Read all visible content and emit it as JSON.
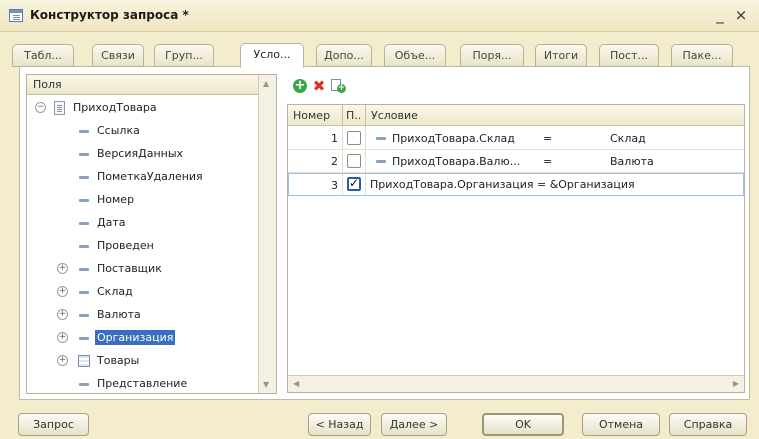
{
  "window": {
    "title": "Конструктор запроса *",
    "minimize": "_",
    "close": "×"
  },
  "tabs": [
    {
      "label": "Табл..."
    },
    {
      "label": "Связи"
    },
    {
      "label": "Груп..."
    },
    {
      "label": "Усло..."
    },
    {
      "label": "Допо..."
    },
    {
      "label": "Объе..."
    },
    {
      "label": "Поря..."
    },
    {
      "label": "Итоги"
    },
    {
      "label": "Пост..."
    },
    {
      "label": "Паке..."
    }
  ],
  "tree": {
    "header": "Поля",
    "items": [
      {
        "label": "ПриходТовара"
      },
      {
        "label": "Ссылка"
      },
      {
        "label": "ВерсияДанных"
      },
      {
        "label": "ПометкаУдаления"
      },
      {
        "label": "Номер"
      },
      {
        "label": "Дата"
      },
      {
        "label": "Проведен"
      },
      {
        "label": "Поставщик"
      },
      {
        "label": "Склад"
      },
      {
        "label": "Валюта"
      },
      {
        "label": "Организация"
      },
      {
        "label": "Товары"
      },
      {
        "label": "Представление"
      }
    ]
  },
  "conditions": {
    "columns": {
      "number": "Номер",
      "flag": "П..",
      "condition": "Условие"
    },
    "rows": [
      {
        "number": "1",
        "field": "ПриходТовара.Склад",
        "op": "=",
        "param": "Склад"
      },
      {
        "number": "2",
        "field": "ПриходТовара.Валю...",
        "op": "=",
        "param": "Валюта"
      },
      {
        "number": "3",
        "text": "ПриходТовара.Организация = &Организация"
      }
    ]
  },
  "icons": {
    "add": "+",
    "delete": "✖",
    "add_icon_plus": "+",
    "expander_minus": "−",
    "expander_plus": "+",
    "scroll_up": "▲",
    "scroll_down": "▼",
    "scroll_left": "◀",
    "scroll_right": "▶"
  },
  "buttons": {
    "query": "Запрос",
    "back": "< Назад",
    "next": "Далее >",
    "ok": "OK",
    "cancel": "Отмена",
    "help": "Справка"
  }
}
